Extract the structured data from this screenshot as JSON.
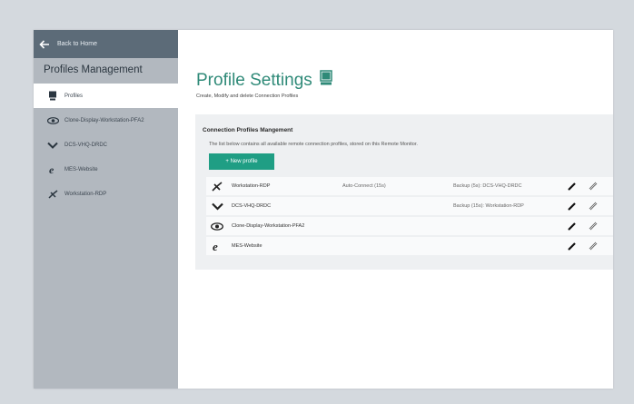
{
  "sidebar": {
    "back_label": "Back to Home",
    "title": "Profiles Management",
    "items": [
      {
        "label": "Profiles",
        "icon": "monitor-icon",
        "active": true
      },
      {
        "label": "Clone-Display-Workstation-PFA2",
        "icon": "eye-icon"
      },
      {
        "label": "DCS-VHQ-DRDC",
        "icon": "chevron-down-icon"
      },
      {
        "label": "MES-Website",
        "icon": "ie-icon"
      },
      {
        "label": "Workstation-RDP",
        "icon": "rdp-icon"
      }
    ]
  },
  "main": {
    "title": "Profile Settings",
    "subtitle": "Create, Modify and delete Connection Profiles",
    "section_heading": "Connection Profiles Mangement",
    "description": "The list below contains all available remote connection profiles, stored on this Remote Monitor.",
    "new_button": "+ New profile",
    "profiles": [
      {
        "name": "Workstation-RDP",
        "auto": "Auto-Connect (15s)",
        "backup": "Backup (5s): DCS-VHQ-DRDC",
        "icon": "rdp-icon"
      },
      {
        "name": "DCS-VHQ-DRDC",
        "auto": "",
        "backup": "Backup (15s): Workstation-RDP",
        "icon": "chevron-down-icon"
      },
      {
        "name": "Clone-Display-Workstation-PFA2",
        "auto": "",
        "backup": "",
        "icon": "eye-icon"
      },
      {
        "name": "MES-Website",
        "auto": "",
        "backup": "",
        "icon": "ie-icon"
      }
    ]
  },
  "colors": {
    "accent": "#1f9e84",
    "title": "#2f8a78",
    "sidebar_bg": "#b2b8bf",
    "back_bar_bg": "#5c6b78"
  }
}
